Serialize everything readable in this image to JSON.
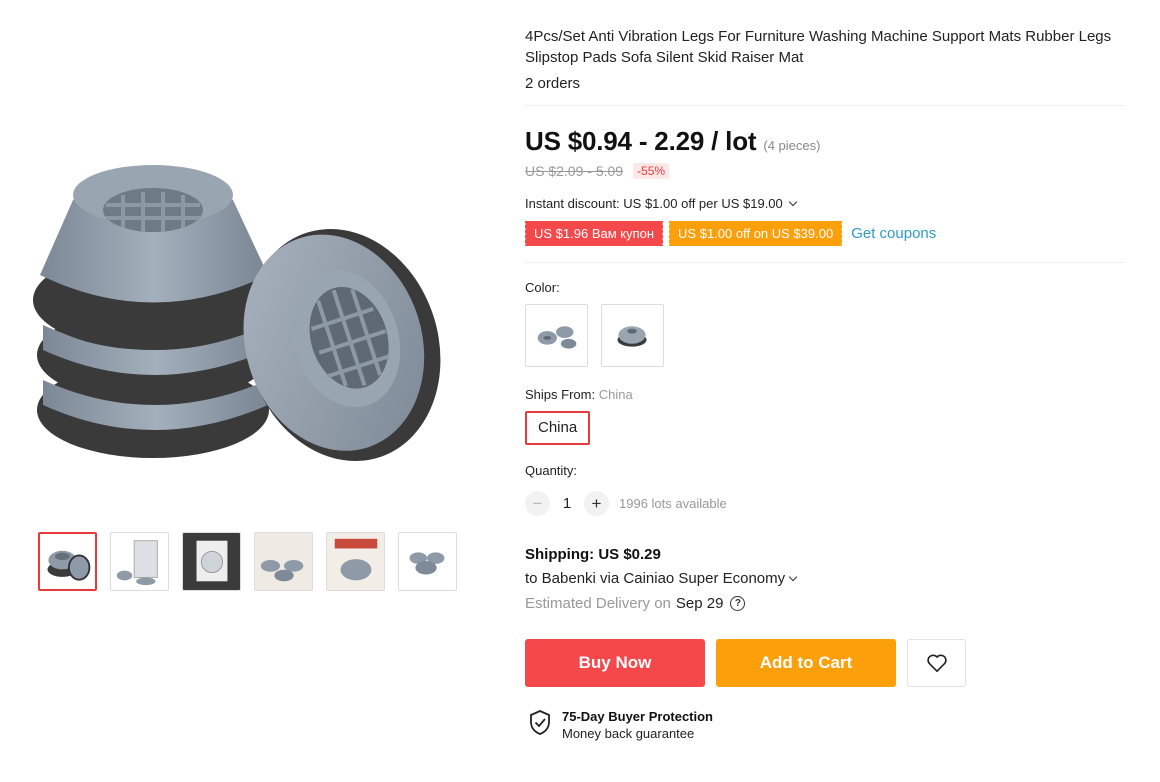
{
  "product": {
    "title": "4Pcs/Set Anti Vibration Legs For Furniture Washing Machine Support Mats Rubber Legs Slipstop Pads Sofa Silent Skid Raiser Mat",
    "orders": "2 orders"
  },
  "gallery": {
    "main_image": "grey rubber anti-vibration feet stack",
    "thumbnails": [
      {
        "name": "thumb-1",
        "selected": true
      },
      {
        "name": "thumb-2",
        "selected": false
      },
      {
        "name": "thumb-3",
        "selected": false
      },
      {
        "name": "thumb-4",
        "selected": false
      },
      {
        "name": "thumb-5",
        "selected": false
      },
      {
        "name": "thumb-6",
        "selected": false
      }
    ]
  },
  "price": {
    "current": "US $0.94 - 2.29 / lot",
    "pieces": "(4 pieces)",
    "original": "US $2.09 - 5.09",
    "discount": "-55%",
    "instant_discount": "Instant discount: US $1.00 off per US $19.00",
    "coupon_1": "US $1.96 Вам купон",
    "coupon_2": "US $1.00 off on US $39.00",
    "get_coupons": "Get coupons"
  },
  "options": {
    "color_label": "Color:",
    "ships_from_label": "Ships From:",
    "ships_from_value": "China",
    "ships_from_option": "China",
    "quantity_label": "Quantity:",
    "quantity": "1",
    "minus": "−",
    "plus": "+",
    "available": "1996 lots available"
  },
  "shipping": {
    "title": "Shipping: US $0.29",
    "via": "to Babenki via Cainiao Super Economy",
    "eta_label": "Estimated Delivery on",
    "eta_date": "Sep 29",
    "help_glyph": "?"
  },
  "actions": {
    "buy_now": "Buy Now",
    "add_to_cart": "Add to Cart"
  },
  "protection": {
    "title": "75-Day Buyer Protection",
    "subtitle": "Money back guarantee"
  },
  "colors": {
    "accent_red": "#f5484b",
    "accent_orange": "#fb9f0b",
    "link_blue": "#2e9cc3",
    "product_grey": "#8e9aa8"
  }
}
